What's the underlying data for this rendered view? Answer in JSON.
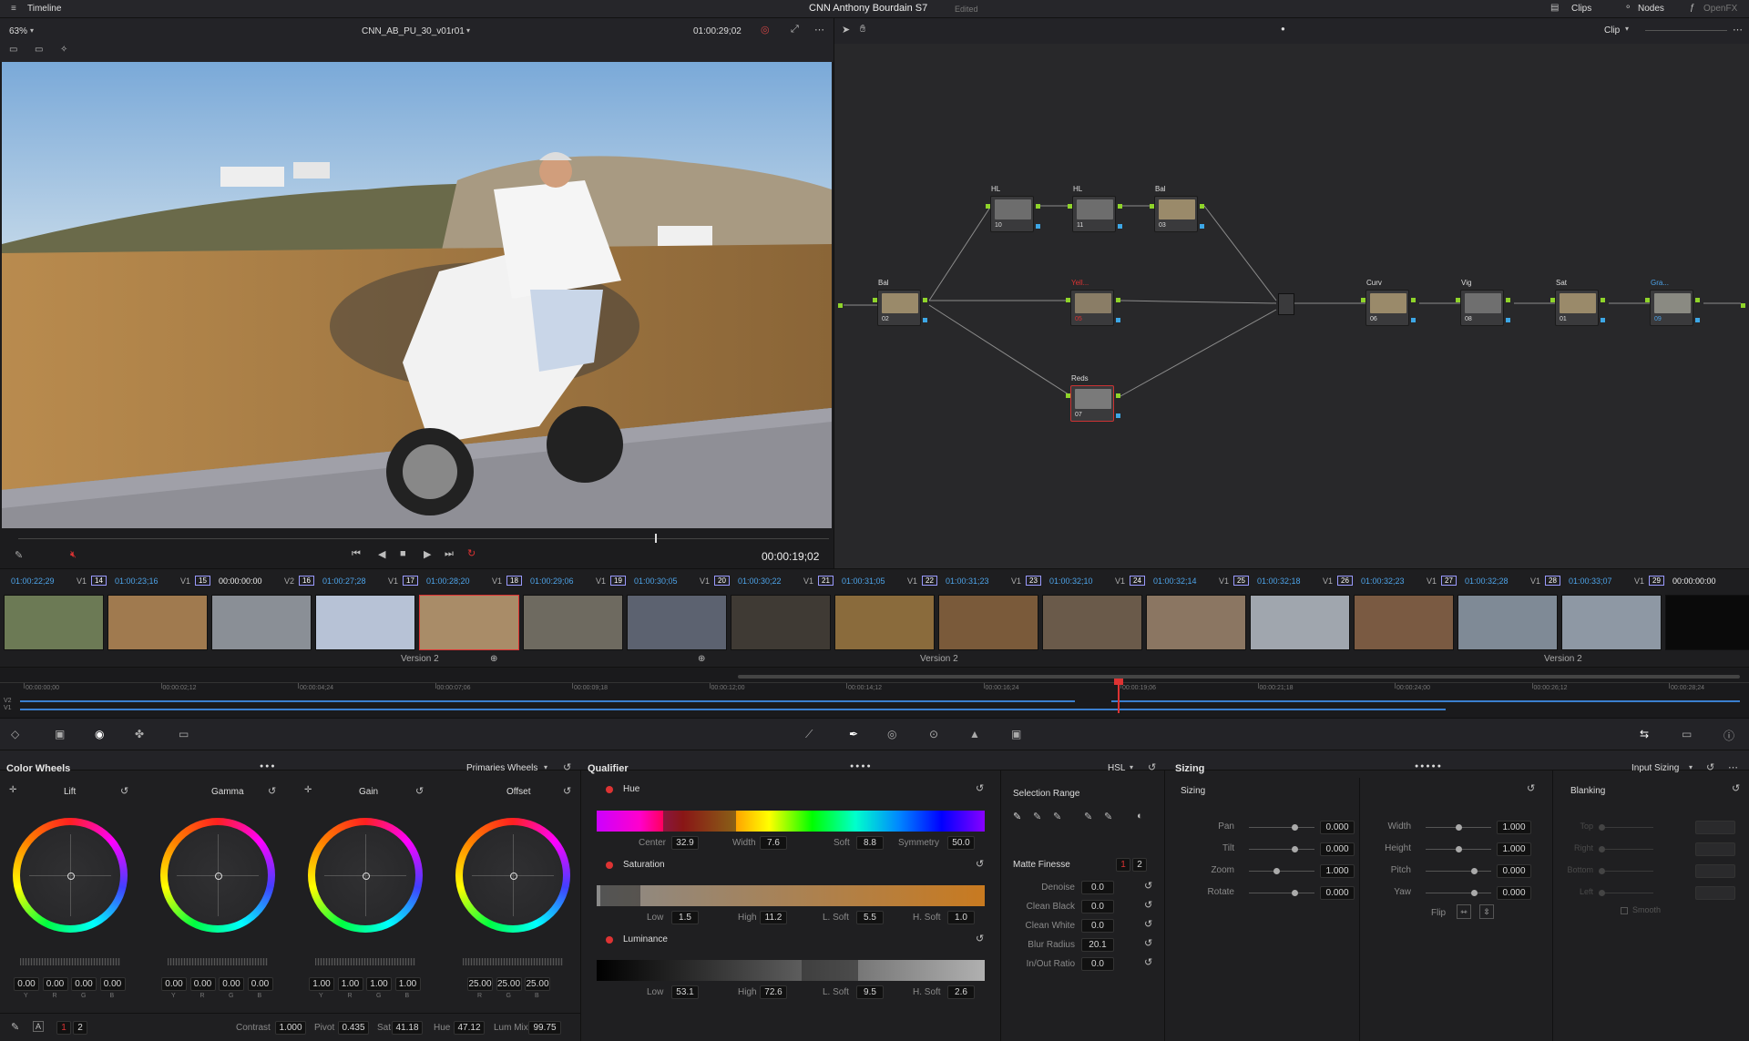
{
  "topbar": {
    "left_label": "Timeline",
    "title": "CNN Anthony Bourdain S7",
    "status": "Edited",
    "clips": "Clips",
    "nodes": "Nodes",
    "openfx": "OpenFX"
  },
  "viewer": {
    "zoom": "63%",
    "clip_name": "CNN_AB_PU_30_v01r01",
    "timecode_top": "01:00:29;02",
    "mode": "Clip",
    "timecode": "00:00:19;02"
  },
  "clips": [
    {
      "tc": "01:00:22;29",
      "track": "V1",
      "num": "14"
    },
    {
      "tc": "01:00:23;16",
      "track": "V1",
      "num": "15"
    },
    {
      "tc": "00:00:00:00",
      "track": "V2",
      "num": "16"
    },
    {
      "tc": "01:00:27;28",
      "track": "V1",
      "num": "17"
    },
    {
      "tc": "01:00:28;20",
      "track": "V1",
      "num": "18"
    },
    {
      "tc": "01:00:29;06",
      "track": "V1",
      "num": "19"
    },
    {
      "tc": "01:00:30;05",
      "track": "V1",
      "num": "20"
    },
    {
      "tc": "01:00:30;22",
      "track": "V1",
      "num": "21"
    },
    {
      "tc": "01:00:31;05",
      "track": "V1",
      "num": "22"
    },
    {
      "tc": "01:00:31;23",
      "track": "V1",
      "num": "23"
    },
    {
      "tc": "01:00:32;10",
      "track": "V1",
      "num": "24"
    },
    {
      "tc": "01:00:32;14",
      "track": "V1",
      "num": "25"
    },
    {
      "tc": "01:00:32;18",
      "track": "V1",
      "num": "26"
    },
    {
      "tc": "01:00:32;23",
      "track": "V1",
      "num": "27"
    },
    {
      "tc": "01:00:32;28",
      "track": "V1",
      "num": "28"
    },
    {
      "tc": "01:00:33;07",
      "track": "V1",
      "num": "29"
    },
    {
      "tc": "00:00:00:00",
      "track": "V2",
      "num": ""
    }
  ],
  "versions": {
    "v1": "Version 2",
    "v2": "Version 2",
    "v3": "Version 2"
  },
  "ruler": [
    "00:00:00;00",
    "00:00:02;12",
    "00:00:04;24",
    "00:00:07;06",
    "00:00:09;18",
    "00:00:12;00",
    "00:00:14;12",
    "00:00:16;24",
    "00:00:19;06",
    "00:00:21;18",
    "00:00:24;00",
    "00:00:26;12",
    "00:00:28;24"
  ],
  "tracks": {
    "v2": "V2",
    "v1": "V1"
  },
  "nodes": [
    {
      "name": "Bal",
      "num": "02"
    },
    {
      "name": "HL",
      "num": "10"
    },
    {
      "name": "HL",
      "num": "11"
    },
    {
      "name": "Bal",
      "num": "03"
    },
    {
      "name": "Yell...",
      "num": "05"
    },
    {
      "name": "Reds",
      "num": "07"
    },
    {
      "name": "Curv",
      "num": "06"
    },
    {
      "name": "Vig",
      "num": "08"
    },
    {
      "name": "Sat",
      "num": "01"
    },
    {
      "name": "Gra...",
      "num": "09"
    }
  ],
  "colorwheels": {
    "title": "Color Wheels",
    "mode": "Primaries Wheels",
    "wheels": [
      {
        "name": "Lift",
        "vals": [
          "0.00",
          "0.00",
          "0.00",
          "0.00"
        ],
        "chan": [
          "Y",
          "R",
          "G",
          "B"
        ]
      },
      {
        "name": "Gamma",
        "vals": [
          "0.00",
          "0.00",
          "0.00",
          "0.00"
        ],
        "chan": [
          "Y",
          "R",
          "G",
          "B"
        ]
      },
      {
        "name": "Gain",
        "vals": [
          "1.00",
          "1.00",
          "1.00",
          "1.00"
        ],
        "chan": [
          "Y",
          "R",
          "G",
          "B"
        ]
      },
      {
        "name": "Offset",
        "vals": [
          "25.00",
          "25.00",
          "25.00"
        ],
        "chan": [
          "R",
          "G",
          "B"
        ]
      }
    ],
    "page1": "1",
    "page2": "2",
    "contrast_label": "Contrast",
    "contrast": "1.000",
    "pivot_label": "Pivot",
    "pivot": "0.435",
    "sat_label": "Sat",
    "sat": "41.18",
    "hue_label": "Hue",
    "hue": "47.12",
    "lummix_label": "Lum Mix",
    "lummix": "99.75"
  },
  "qualifier": {
    "title": "Qualifier",
    "mode": "HSL",
    "hue": {
      "label": "Hue",
      "center_l": "Center",
      "center": "32.9",
      "width_l": "Width",
      "width": "7.6",
      "soft_l": "Soft",
      "soft": "8.8",
      "sym_l": "Symmetry",
      "sym": "50.0"
    },
    "sat": {
      "label": "Saturation",
      "low_l": "Low",
      "low": "1.5",
      "high_l": "High",
      "high": "11.2",
      "lsoft_l": "L. Soft",
      "lsoft": "5.5",
      "hsoft_l": "H. Soft",
      "hsoft": "1.0"
    },
    "lum": {
      "label": "Luminance",
      "low_l": "Low",
      "low": "53.1",
      "high_l": "High",
      "high": "72.6",
      "lsoft_l": "L. Soft",
      "lsoft": "9.5",
      "hsoft_l": "H. Soft",
      "hsoft": "2.6"
    },
    "selection_range": "Selection Range",
    "matte_finesse": "Matte Finesse",
    "mf1": "1",
    "mf2": "2",
    "finesse": [
      {
        "label": "Denoise",
        "val": "0.0"
      },
      {
        "label": "Clean Black",
        "val": "0.0"
      },
      {
        "label": "Clean White",
        "val": "0.0"
      },
      {
        "label": "Blur Radius",
        "val": "20.1"
      },
      {
        "label": "In/Out Ratio",
        "val": "0.0"
      }
    ]
  },
  "sizing": {
    "title": "Sizing",
    "mode": "Input Sizing",
    "section": "Sizing",
    "left": [
      {
        "label": "Pan",
        "val": "0.000"
      },
      {
        "label": "Tilt",
        "val": "0.000"
      },
      {
        "label": "Zoom",
        "val": "1.000"
      },
      {
        "label": "Rotate",
        "val": "0.000"
      }
    ],
    "right": [
      {
        "label": "Width",
        "val": "1.000"
      },
      {
        "label": "Height",
        "val": "1.000"
      },
      {
        "label": "Pitch",
        "val": "0.000"
      },
      {
        "label": "Yaw",
        "val": "0.000"
      }
    ],
    "flip": "Flip",
    "blanking": "Blanking",
    "blank_items": [
      "Top",
      "Right",
      "Bottom",
      "Left"
    ],
    "smooth": "Smooth"
  }
}
